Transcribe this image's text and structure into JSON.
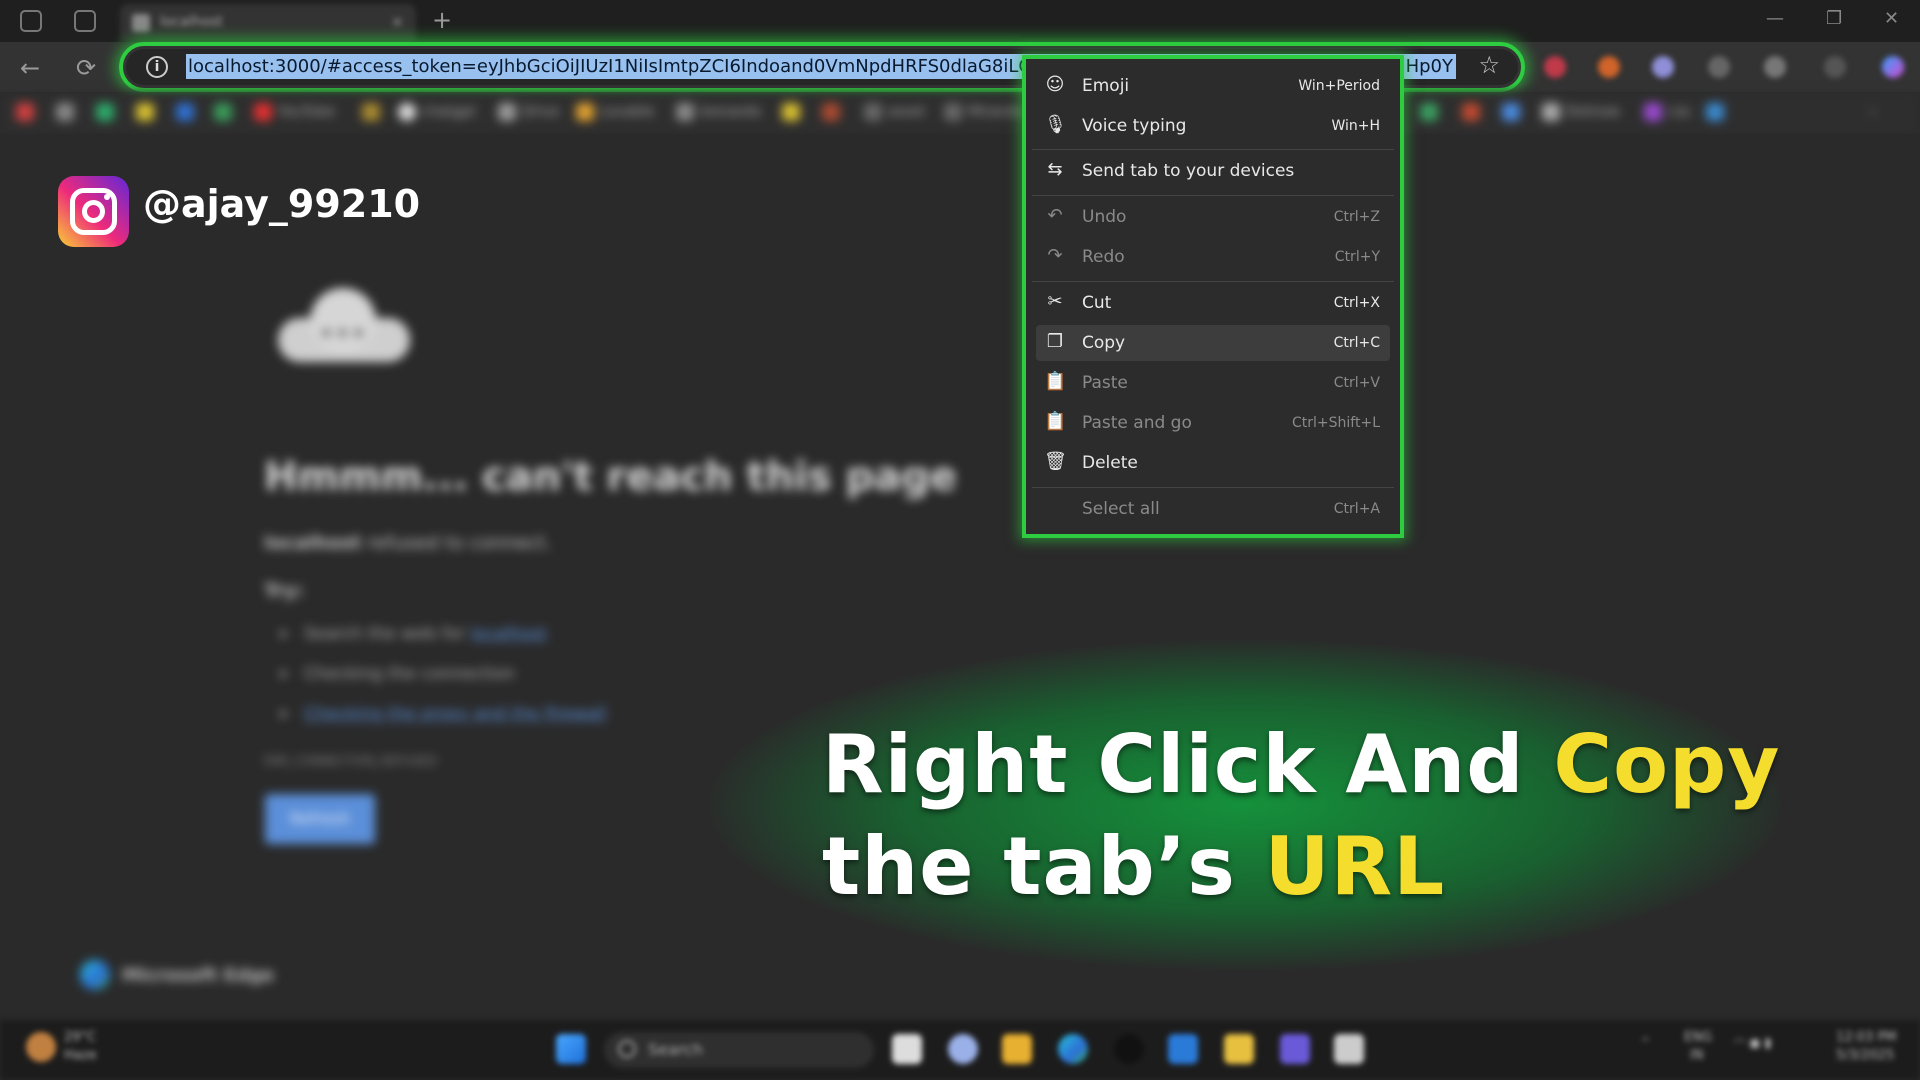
{
  "browser": {
    "tab_title": "localhost",
    "tab_close": "×",
    "new_tab": "+",
    "url": "localhost:3000/#access_token=eyJhbGciOiJIUzI1NiIsImtpZCI6Indoand0VmNpdHRFS0dlaG8iLCJ0eXAiOiJKV1Q...yaHp0Y",
    "url_visible_left": "localhost:3000/#access_token=eyJhbGciOiJIUzI1NiIsImtpZCI6Indoand0VmNpdHRFS0dlaG8iLCJ0eXAiOiJKV1Q",
    "url_visible_right": "yaHp0Y",
    "info_icon": "i",
    "star_icon": "☆"
  },
  "bookmarks": [
    "YouTube",
    "chatgpt",
    "Drive",
    "Lovable",
    "leonardo",
    "asset",
    "Miranda",
    "Dotnow",
    "css"
  ],
  "error_page": {
    "title": "Hmmm... can't reach this page",
    "host": "localhost",
    "desc_rest": " refused to connect.",
    "try_label": "Try:",
    "suggestions": [
      {
        "prefix": "Search the web for ",
        "link": "localhost"
      },
      {
        "prefix": "Checking the connection",
        "link": ""
      },
      {
        "prefix": "",
        "link": "Checking the proxy and the firewall"
      }
    ],
    "error_code": "ERR_CONNECTION_REFUSED",
    "refresh_label": "Refresh",
    "brand": "Microsoft Edge"
  },
  "overlay": {
    "handle": "@ajay_99210",
    "caption_line1_a": "Right Click And ",
    "caption_line1_b": "Copy",
    "caption_line2_a": "the tab’s ",
    "caption_line2_b": "URL"
  },
  "context_menu": {
    "items": [
      {
        "icon": "☺",
        "label": "Emoji",
        "shortcut": "Win+Period",
        "enabled": true
      },
      {
        "icon": "🎙",
        "label": "Voice typing",
        "shortcut": "Win+H",
        "enabled": true
      },
      {
        "icon": "⇆",
        "label": "Send tab to your devices",
        "shortcut": "",
        "enabled": true
      },
      {
        "icon": "↶",
        "label": "Undo",
        "shortcut": "Ctrl+Z",
        "enabled": false
      },
      {
        "icon": "↷",
        "label": "Redo",
        "shortcut": "Ctrl+Y",
        "enabled": false
      },
      {
        "icon": "✂",
        "label": "Cut",
        "shortcut": "Ctrl+X",
        "enabled": true
      },
      {
        "icon": "❐",
        "label": "Copy",
        "shortcut": "Ctrl+C",
        "enabled": true,
        "hovered": true
      },
      {
        "icon": "📋",
        "label": "Paste",
        "shortcut": "Ctrl+V",
        "enabled": false
      },
      {
        "icon": "📋",
        "label": "Paste and go",
        "shortcut": "Ctrl+Shift+L",
        "enabled": false
      },
      {
        "icon": "🗑",
        "label": "Delete",
        "shortcut": "",
        "enabled": true
      },
      {
        "icon": "",
        "label": "Select all",
        "shortcut": "Ctrl+A",
        "enabled": false
      }
    ]
  },
  "taskbar": {
    "search_label": "Search",
    "weather": "29°C",
    "weather_desc": "Haze",
    "lang": "ENG",
    "lang2": "IN",
    "time": "12:03 PM",
    "date": "5/3/2025"
  },
  "colors": {
    "highlight_green": "#2ecc40",
    "caption_yellow": "#f5dd2d",
    "url_selection": "#99c1f0"
  }
}
